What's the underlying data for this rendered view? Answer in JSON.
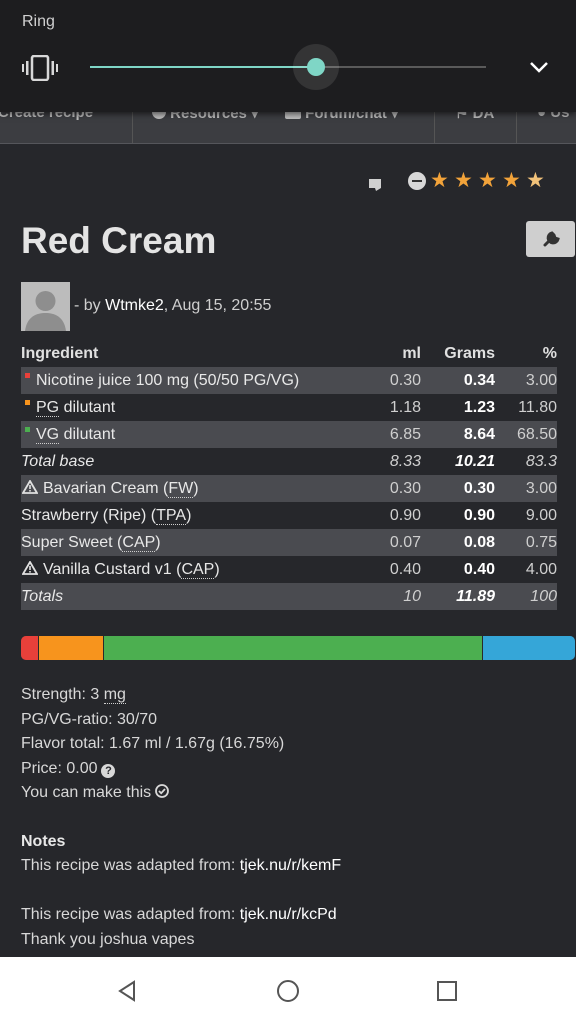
{
  "ring_panel": {
    "title": "Ring",
    "volume_level": 0.57,
    "accent_color": "#7fd6c6"
  },
  "site_nav": {
    "items": [
      {
        "label": "Create recipe",
        "icon": "none"
      },
      {
        "label": "Resources",
        "icon": "info-icon"
      },
      {
        "label": "Forum/chat",
        "icon": "chat-icon"
      },
      {
        "label": "DA",
        "icon": "flag-icon"
      },
      {
        "label": "Us",
        "icon": "user-icon"
      }
    ]
  },
  "rating": {
    "stars": 4.5,
    "star_color": "#f2a33a"
  },
  "recipe": {
    "title": "Red Cream",
    "byline_prefix": "- by ",
    "author": "Wtmke2",
    "date": ", Aug 15, 20:55"
  },
  "table": {
    "headers": [
      "Ingredient",
      "ml",
      "Grams",
      "%"
    ],
    "rows": [
      {
        "name": "Nicotine juice 100 mg (50/50 PG/VG)",
        "ml": "0.30",
        "grams": "0.34",
        "pct": "3.00",
        "marker_color": "#e8403a"
      },
      {
        "name_pre": "",
        "abbr": "PG",
        "name_post": " dilutant",
        "ml": "1.18",
        "grams": "1.23",
        "pct": "11.80",
        "marker_color": "#f7941d"
      },
      {
        "name_pre": "",
        "abbr": "VG",
        "name_post": " dilutant",
        "ml": "6.85",
        "grams": "8.64",
        "pct": "68.50",
        "marker_color": "#4caf50"
      },
      {
        "name": "Total base",
        "ml": "8.33",
        "grams": "10.21",
        "pct": "83.3"
      },
      {
        "name_pre": "Bavarian Cream (",
        "abbr": "FW",
        "name_post": ")",
        "ml": "0.30",
        "grams": "0.30",
        "pct": "3.00"
      },
      {
        "name_pre": "Strawberry (Ripe) (",
        "abbr": "TPA",
        "name_post": ")",
        "ml": "0.90",
        "grams": "0.90",
        "pct": "9.00"
      },
      {
        "name_pre": "Super Sweet (",
        "abbr": "CAP",
        "name_post": ")",
        "ml": "0.07",
        "grams": "0.08",
        "pct": "0.75"
      },
      {
        "name_pre": "Vanilla Custard v1 (",
        "abbr": "CAP",
        "name_post": ")",
        "ml": "0.40",
        "grams": "0.40",
        "pct": "4.00"
      },
      {
        "name": "Totals",
        "ml": "10",
        "grams": "11.89",
        "pct": "100"
      }
    ]
  },
  "composition_bar": {
    "segments": [
      {
        "label": "Nicotine",
        "fraction": 0.03,
        "color": "#e8403a"
      },
      {
        "label": "PG",
        "fraction": 0.118,
        "color": "#f7941d"
      },
      {
        "label": "VG",
        "fraction": 0.685,
        "color": "#4caf50"
      },
      {
        "label": "Flavor",
        "fraction": 0.1675,
        "color": "#35a6d8"
      }
    ]
  },
  "info": {
    "strength_label": "Strength: 3 ",
    "strength_unit": "mg",
    "ratio": "PG/VG-ratio: 30/70",
    "flavor_total": "Flavor total: 1.67 ml / 1.67g (16.75%)",
    "price": "Price: 0.00",
    "can_make": "You can make this"
  },
  "notes": {
    "heading": "Notes",
    "line1_prefix": "This recipe was adapted from: ",
    "line1_link": "tjek.nu/r/kemF",
    "line2_prefix": "This recipe was adapted from: ",
    "line2_link": "tjek.nu/r/kcPd",
    "line3": "Thank you joshua vapes"
  }
}
